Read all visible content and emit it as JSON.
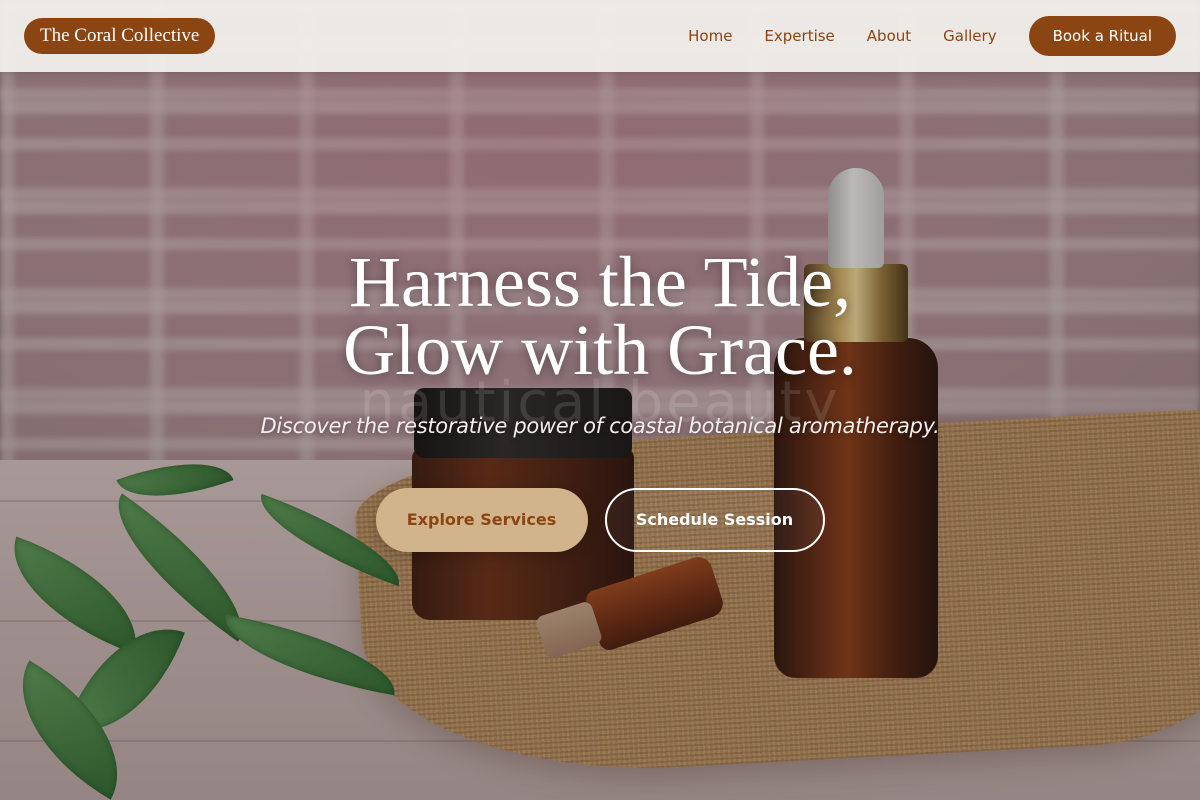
{
  "header": {
    "logo": "The Coral Collective",
    "nav": [
      {
        "label": "Home"
      },
      {
        "label": "Expertise"
      },
      {
        "label": "About"
      },
      {
        "label": "Gallery"
      }
    ],
    "cta_label": "Book a Ritual"
  },
  "hero": {
    "headline_line1": "Harness the Tide,",
    "headline_line2": "Glow with Grace.",
    "background_watermark": "nautical beauty",
    "subtitle": "Discover the restorative power of coastal botanical aromatherapy.",
    "primary_button": "Explore Services",
    "secondary_button": "Schedule Session"
  },
  "colors": {
    "brand": "#8b4513",
    "accent_tan": "#d2b48c",
    "header_bg": "#f2f0ec",
    "text_light": "#ffffff"
  }
}
